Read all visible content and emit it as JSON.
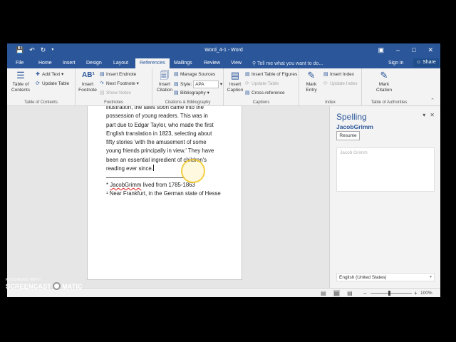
{
  "window": {
    "title": "Word_4-1  -  Word",
    "qat_icons": [
      "save-icon",
      "undo-icon",
      "redo-icon",
      "customize-icon"
    ],
    "controls": [
      "restore-ribbon-icon",
      "minimize-icon",
      "maximize-icon",
      "close-icon"
    ]
  },
  "tabs": [
    {
      "label": "File"
    },
    {
      "label": "Home"
    },
    {
      "label": "Insert"
    },
    {
      "label": "Design"
    },
    {
      "label": "Layout"
    },
    {
      "label": "References"
    },
    {
      "label": "Mailings"
    },
    {
      "label": "Review"
    },
    {
      "label": "View"
    }
  ],
  "active_tab": "References",
  "tell_me": "Tell me what you want to do...",
  "signin": "Sign in",
  "share": "Share",
  "ribbon": {
    "toc": {
      "big_label": "Table of\nContents",
      "add_text": "Add Text",
      "update_table": "Update Table",
      "group": "Table of Contents"
    },
    "footnotes": {
      "big_label": "Insert\nFootnote",
      "insert_endnote": "Insert Endnote",
      "next_footnote": "Next Footnote",
      "show_notes": "Show Notes",
      "group": "Footnotes"
    },
    "citations": {
      "big_label": "Insert\nCitation",
      "manage_sources": "Manage Sources",
      "style_label": "Style:",
      "style_value": "APA",
      "bibliography": "Bibliography",
      "group": "Citations & Bibliography"
    },
    "captions": {
      "big_label": "Insert\nCaption",
      "insert_table_figures": "Insert Table of Figures",
      "update_table": "Update Table",
      "cross_reference": "Cross-reference",
      "group": "Captions"
    },
    "index": {
      "big_label": "Mark\nEntry",
      "insert_index": "Insert Index",
      "update_index": "Update Index",
      "group": "Index"
    },
    "toa": {
      "big_label": "Mark\nCitation",
      "group": "Table of Authorities"
    }
  },
  "document": {
    "lines": [
      "illustration, the tales soon came into the",
      "possession of young readers. This was in",
      "part due to Edgar Taylor, who made the first",
      "English translation in 1823, selecting about",
      "fifty stories 'with the amusement of some",
      "young friends principally in view.' They have",
      "been an essential ingredient of children's",
      "reading ever since."
    ],
    "footnote1_marker": "*",
    "footnote1_word": "JacobGrimm",
    "footnote1_rest": " lived from 1785-1863",
    "footnote2": "¹ Near Frankfurt, in the German state of Hesse"
  },
  "spelling": {
    "title": "Spelling",
    "word": "JacobGrimm",
    "resume": "Resume",
    "suggestion": "Jacob Grimm",
    "language": "English (United States)"
  },
  "status": {
    "zoom": "100%"
  },
  "watermark": {
    "recorded": "RECORDED WITH",
    "brand_left": "SCREENCAST",
    "brand_right": "MATIC"
  }
}
